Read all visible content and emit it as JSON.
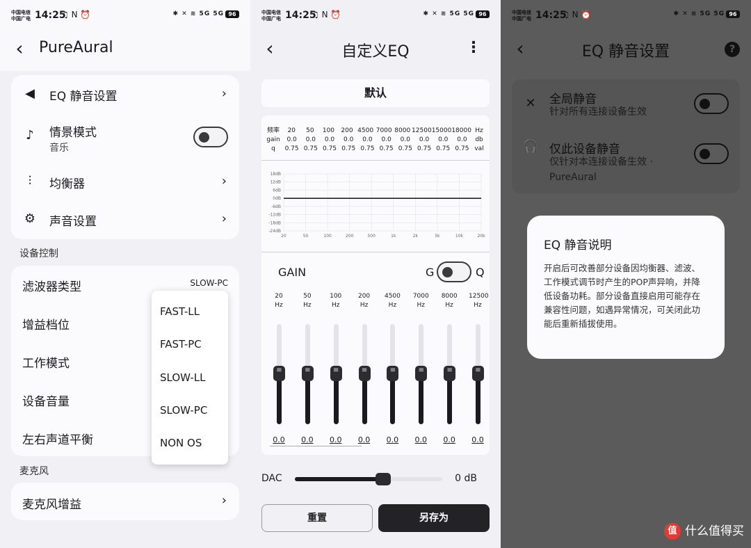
{
  "status": {
    "carrier1": "中国电信",
    "carrier2": "中国广电",
    "time": "14:25",
    "left_icons": "♫ N ⏰",
    "right_icons": "✱ ✕ ≋ 5G 5G",
    "battery": "96"
  },
  "p1": {
    "title": "PureAural",
    "items": [
      {
        "label": "EQ 静音设置",
        "icon": "speaker-icon"
      },
      {
        "label": "情景模式",
        "sub": "音乐",
        "icon": "music-note-icon"
      },
      {
        "label": "均衡器",
        "icon": "equalizer-icon"
      },
      {
        "label": "声音设置",
        "icon": "gear-icon"
      }
    ],
    "section_device": "设备控制",
    "device_items": [
      {
        "label": "滤波器类型",
        "value": "SLOW-PC"
      },
      {
        "label": "增益档位"
      },
      {
        "label": "工作模式"
      },
      {
        "label": "设备音量"
      },
      {
        "label": "左右声道平衡"
      }
    ],
    "dropdown": [
      "FAST-LL",
      "FAST-PC",
      "SLOW-LL",
      "SLOW-PC",
      "NON OS"
    ],
    "section_mic": "麦克风",
    "mic_gain": "麦克风增益"
  },
  "p2": {
    "title": "自定义EQ",
    "preset": "默认",
    "table": {
      "freq_label": "频率",
      "gain_label": "gain",
      "q_label": "q",
      "freqs": [
        "20",
        "50",
        "100",
        "200",
        "4500",
        "7000",
        "8000",
        "12500",
        "15000",
        "18000"
      ],
      "gains": [
        "0.0",
        "0.0",
        "0.0",
        "0.0",
        "0.0",
        "0.0",
        "0.0",
        "0.0",
        "0.0",
        "0.0"
      ],
      "qs": [
        "0.75",
        "0.75",
        "0.75",
        "0.75",
        "0.75",
        "0.75",
        "0.75",
        "0.75",
        "0.75",
        "0.75"
      ],
      "freq_unit": "Hz",
      "gain_unit": "db",
      "q_unit": "val"
    },
    "graph": {
      "y_ticks": [
        "18dB",
        "12dB",
        "6dB",
        "0dB",
        "-6dB",
        "-12dB",
        "-18dB",
        "-24dB"
      ],
      "x_ticks": [
        "20",
        "50",
        "100",
        "200",
        "500",
        "1k",
        "2k",
        "5k",
        "10k",
        "20k"
      ],
      "curve_value": 0
    },
    "gain_label": "GAIN",
    "toggle_g": "G",
    "toggle_q": "Q",
    "bands": [
      {
        "freq": "20",
        "unit": "Hz",
        "value": "0.0"
      },
      {
        "freq": "50",
        "unit": "Hz",
        "value": "0.0"
      },
      {
        "freq": "100",
        "unit": "Hz",
        "value": "0.0"
      },
      {
        "freq": "200",
        "unit": "Hz",
        "value": "0.0"
      },
      {
        "freq": "4500",
        "unit": "Hz",
        "value": "0.0"
      },
      {
        "freq": "7000",
        "unit": "Hz",
        "value": "0.0"
      },
      {
        "freq": "8000",
        "unit": "Hz",
        "value": "0.0"
      },
      {
        "freq": "12500",
        "unit": "Hz",
        "value": "0.0"
      }
    ],
    "dac_label": "DAC",
    "dac_value": "0 dB",
    "dac_level": 0.6,
    "reset": "重置",
    "save_as": "另存为"
  },
  "p3": {
    "title": "EQ 静音设置",
    "global_mute": "全局静音",
    "global_mute_sub": "针对所有连接设备生效",
    "device_mute": "仅此设备静音",
    "device_mute_sub": "仅针对本连接设备生效 · PureAural",
    "dialog_title": "EQ 静音说明",
    "dialog_body": "开启后可改善部分设备因均衡器、滤波、工作模式调节时产生的POP声异响，并降低设备功耗。部分设备直接启用可能存在兼容性问题，如遇异常情况，可关闭此功能后重新插拔使用。",
    "watermark_logo": "值",
    "watermark": "什么值得买"
  },
  "colors": {
    "accent": "#1b1b1f",
    "card": "#fbfbfd",
    "bg": "#f1f1f5",
    "overlay": "#5b5b5b"
  }
}
